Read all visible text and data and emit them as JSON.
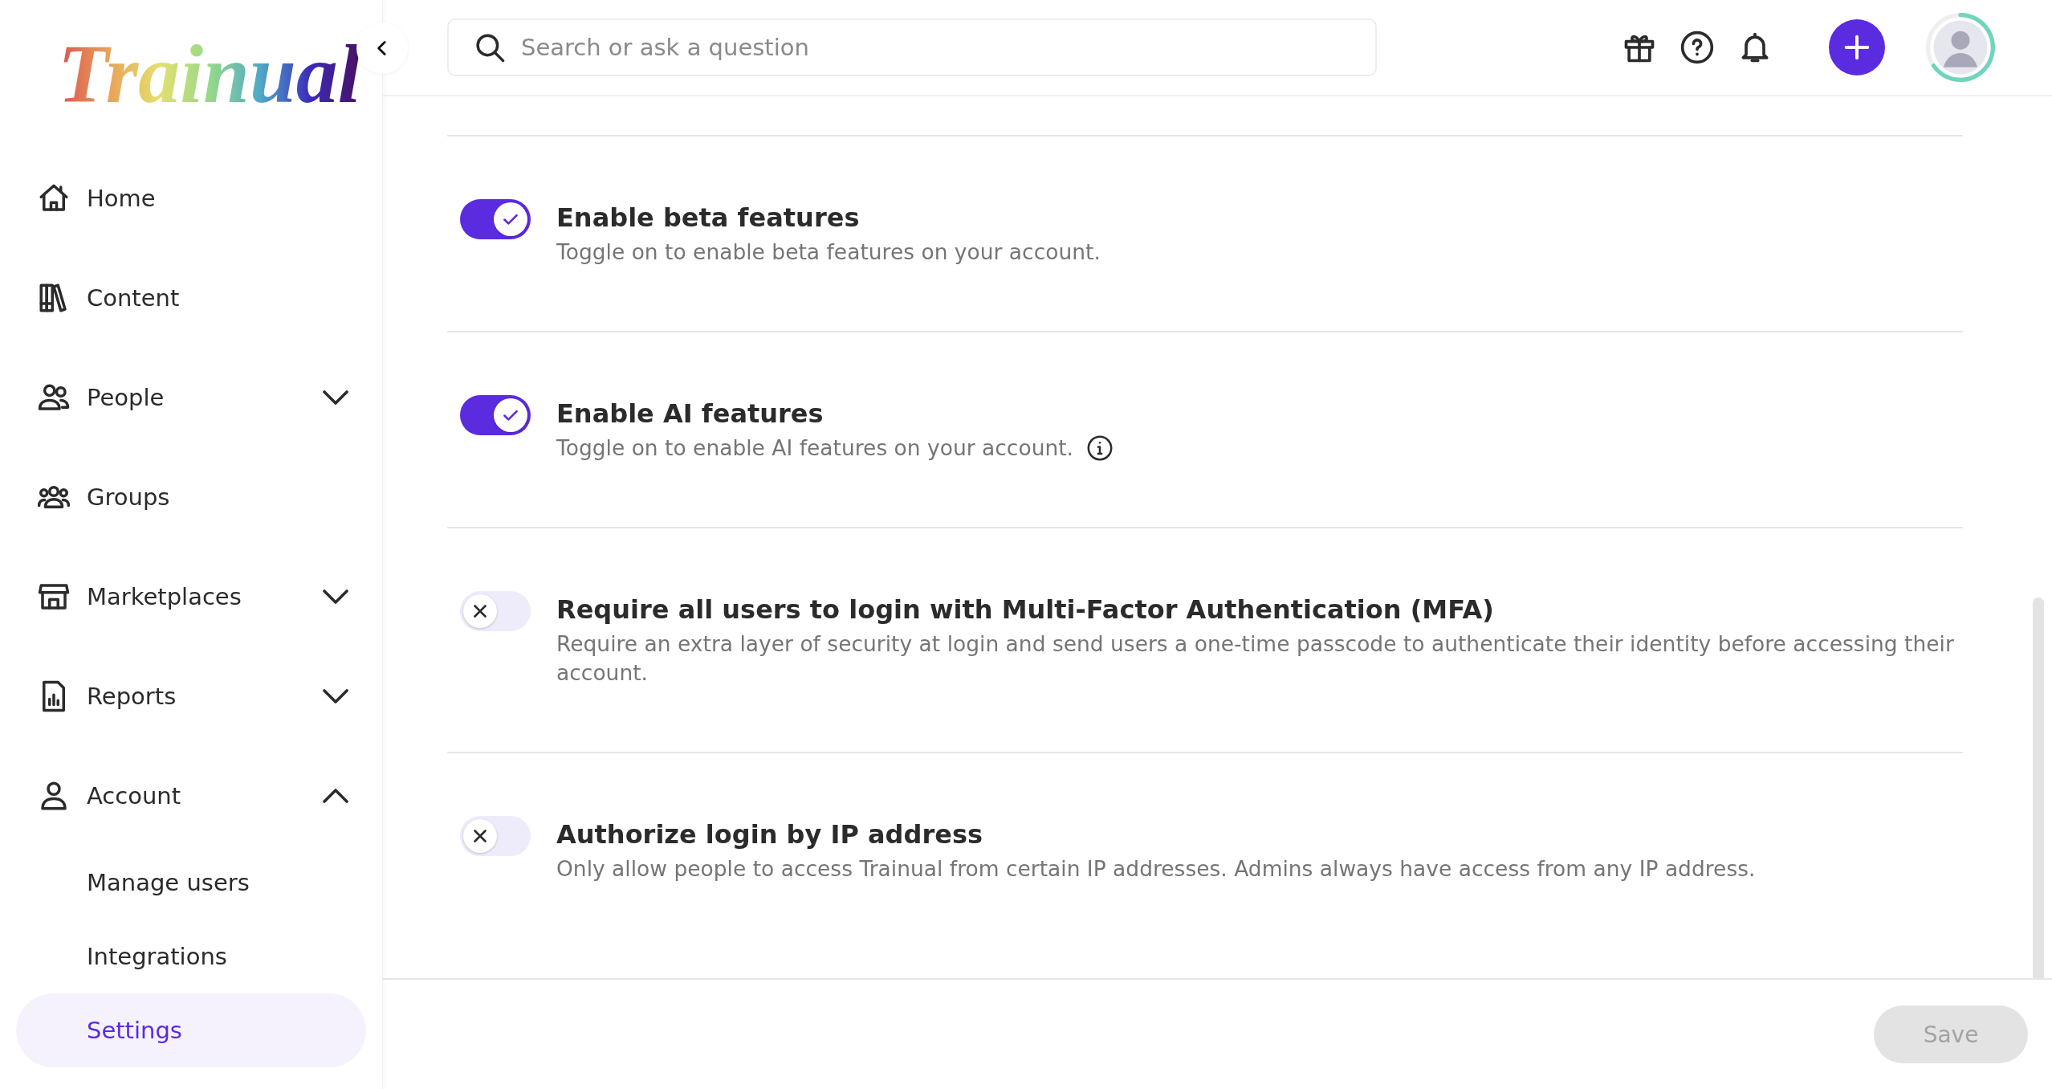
{
  "logo": {
    "text": "Trainual"
  },
  "sidebar": {
    "items": [
      {
        "label": "Home",
        "selected": false
      },
      {
        "label": "Content",
        "selected": false
      },
      {
        "label": "People",
        "selected": false,
        "expanded": false
      },
      {
        "label": "Groups",
        "selected": false
      },
      {
        "label": "Marketplaces",
        "selected": false,
        "expanded": false
      },
      {
        "label": "Reports",
        "selected": false,
        "expanded": false
      },
      {
        "label": "Account",
        "selected": false,
        "expanded": true,
        "children": [
          {
            "label": "Manage users",
            "selected": false
          },
          {
            "label": "Integrations",
            "selected": false
          },
          {
            "label": "Settings",
            "selected": true
          }
        ]
      }
    ]
  },
  "search": {
    "placeholder": "Search or ask a question"
  },
  "settings": [
    {
      "title": "Enable beta features",
      "description": "Toggle on to enable beta features on your account.",
      "on": true,
      "info": false
    },
    {
      "title": "Enable AI features",
      "description": "Toggle on to enable AI features on your account.",
      "on": true,
      "info": true
    },
    {
      "title": "Require all users to login with Multi-Factor Authentication (MFA)",
      "description": "Require an extra layer of security at login and send users a one-time passcode to authenticate their identity before accessing their account.",
      "on": false,
      "info": false
    },
    {
      "title": "Authorize login by IP address",
      "description": "Only allow people to access Trainual from certain IP addresses. Admins always have access from any IP address.",
      "on": false,
      "info": false
    }
  ],
  "footer": {
    "save_button": {
      "label": "Save",
      "disabled": true
    }
  }
}
